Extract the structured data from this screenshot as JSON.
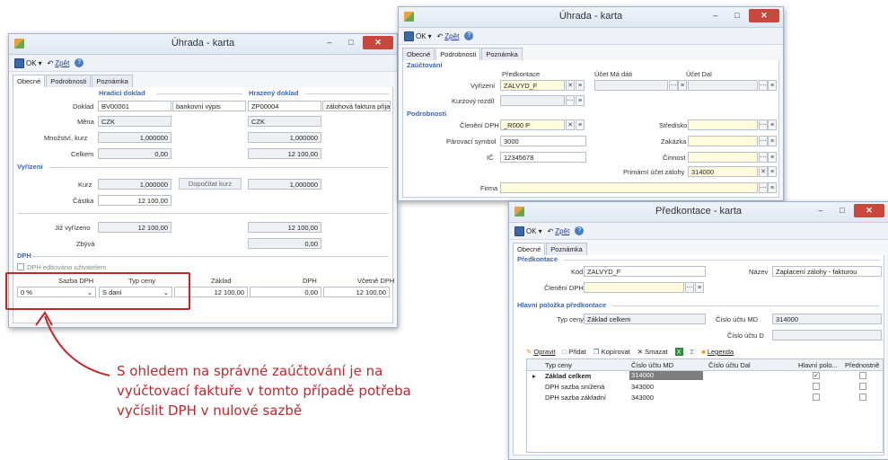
{
  "win1": {
    "title": "Úhrada - karta",
    "toolbar": {
      "ok": "OK",
      "zpet": "Zpět"
    },
    "tabs": [
      "Obecné",
      "Podrobnosti",
      "Poznámka"
    ],
    "sections": {
      "hradici": "Hradicí doklad",
      "hrazeny": "Hrazený doklad",
      "vyrizeni": "Vyřízení",
      "dph": "DPH"
    },
    "labels": {
      "doklad": "Doklad",
      "mena": "Měna",
      "mnozstvi_kurz": "Množství, kurz",
      "celkem": "Celkem",
      "kurz": "Kurz",
      "castka": "Částka",
      "jiz_vyrizeno": "Již vyřízeno",
      "zbyva": "Zbývá",
      "dph_edit": "DPH editováno uživatelem",
      "sazba_dph": "Sazba DPH",
      "typ_ceny": "Typ ceny",
      "zaklad": "Základ",
      "dph": "DPH",
      "vcetne_dph": "Včetně DPH"
    },
    "values": {
      "doklad1": "BV00001",
      "doklad1_type": "bankovní výpis",
      "doklad2": "ZP00004",
      "doklad2_type": "zálohová faktura přijatá",
      "mena1": "CZK",
      "mena2": "CZK",
      "kurz1": "1,000000",
      "kurz2": "1,000000",
      "celkem1": "0,00",
      "celkem2": "12 100,00",
      "vyr_kurz1": "1,000000",
      "dopocitat": "Dopočítat kurz",
      "vyr_kurz2": "1,000000",
      "castka": "12 100,00",
      "jiz1": "12 100,00",
      "jiz2": "12 100,00",
      "zbyva": "0,00",
      "sazba": "0 %",
      "typ": "S daní",
      "zaklad": "12 100,00",
      "dph": "0,00",
      "vcetne": "12 100,00"
    }
  },
  "win2": {
    "title": "Úhrada - karta",
    "toolbar": {
      "ok": "OK",
      "zpet": "Zpět"
    },
    "tabs": [
      "Obecné",
      "Podrobnosti",
      "Poznámka"
    ],
    "sections": {
      "zauctovani": "Zaúčtování",
      "podrobnosti": "Podrobnosti"
    },
    "labels": {
      "predkontace": "Předkontace",
      "ucet_ma_dati": "Účet Má dáti",
      "ucet_dal": "Účet Dal",
      "vyrizeni": "Vyřízení",
      "kurzovy_rozdil": "Kurzový rozdíl",
      "cleneni_dph": "Členění DPH",
      "parovaci_symbol": "Párovací symbol",
      "ic": "IČ",
      "stredisko": "Středisko",
      "zakazka": "Zakázka",
      "cinnost": "Činnost",
      "primarni_ucet": "Primární účet zálohy",
      "firma": "Firma"
    },
    "values": {
      "vyrizeni": "ZALVYD_F",
      "cleneni_dph": "_R000 P",
      "parovaci_symbol": "3000",
      "ic": "12345678",
      "primarni_ucet": "314000"
    }
  },
  "win3": {
    "title": "Předkontace - karta",
    "toolbar": {
      "ok": "OK",
      "zpet": "Zpět"
    },
    "tabs": [
      "Obecné",
      "Poznámka"
    ],
    "sections": {
      "predkontace": "Předkontace",
      "hlavni": "Hlavní položka předkontace"
    },
    "labels": {
      "kod": "Kód",
      "nazev": "Název",
      "cleneni_dph": "Členění DPH",
      "typ_ceny": "Typ ceny",
      "cislo_uctu_md": "Číslo účtu MD",
      "cislo_uctu_d": "Číslo účtu D"
    },
    "values": {
      "kod": "ZALVYD_F",
      "nazev": "Zaplacení zálohy - fakturou",
      "typ_ceny": "Základ celkem",
      "cislo_uctu_md": "314000"
    },
    "grid_toolbar": [
      "Opravit",
      "Přidat",
      "Kopírovat",
      "Smazat",
      "Legenda"
    ],
    "grid_columns": [
      "Typ ceny",
      "Číslo účtu MD",
      "Číslo účtu Dal",
      "Hlavní polo...",
      "Přednostně"
    ],
    "grid_rows": [
      {
        "typ": "Základ celkem",
        "md": "314000",
        "dal": "",
        "hlavni": true,
        "prednostne": false
      },
      {
        "typ": "DPH sazba snížená",
        "md": "343000",
        "dal": "",
        "hlavni": false,
        "prednostne": false
      },
      {
        "typ": "DPH sazba základní",
        "md": "343000",
        "dal": "",
        "hlavni": false,
        "prednostne": false
      }
    ]
  },
  "annotation": {
    "line1": "S ohledem na správné zaúčtování je na",
    "line2": "vyúčtovací faktuře v tomto případě potřeba",
    "line3": "vyčíslit DPH v nulové sazbě"
  },
  "colors": {
    "accent": "#3a67b5",
    "annotation": "#c4262b",
    "close": "#c9483d"
  }
}
